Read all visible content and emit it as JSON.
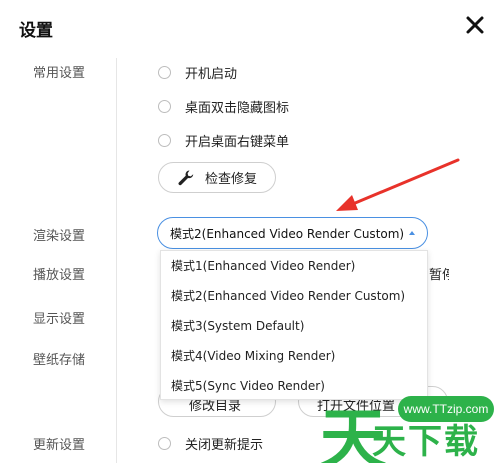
{
  "window": {
    "title": "设置"
  },
  "sections": {
    "common": "常用设置",
    "render": "渲染设置",
    "playback": "播放设置",
    "display": "显示设置",
    "wallpaper": "壁纸存储",
    "update": "更新设置"
  },
  "common": {
    "options": [
      "开机启动",
      "桌面双击隐藏图标",
      "开启桌面右键菜单"
    ],
    "repair_button": "检查修复"
  },
  "render": {
    "selected": "模式2(Enhanced Video Render Custom)",
    "options": [
      "模式1(Enhanced Video Render)",
      "模式2(Enhanced Video Render Custom)",
      "模式3(System Default)",
      "模式4(Video Mixing Render)",
      "模式5(Sync Video Render)"
    ]
  },
  "playback": {
    "partial_text": "暂停"
  },
  "wallpaper": {
    "change_dir_button": "修改目录",
    "open_location_button": "打开文件位置"
  },
  "update": {
    "option": "关闭更新提示"
  },
  "watermark": {
    "url": "www.TTzip.com",
    "big": "天",
    "chars": "天下载"
  },
  "colors": {
    "accent": "#4a90e2",
    "arrow": "#e8322a",
    "watermark": "#2db24a"
  }
}
